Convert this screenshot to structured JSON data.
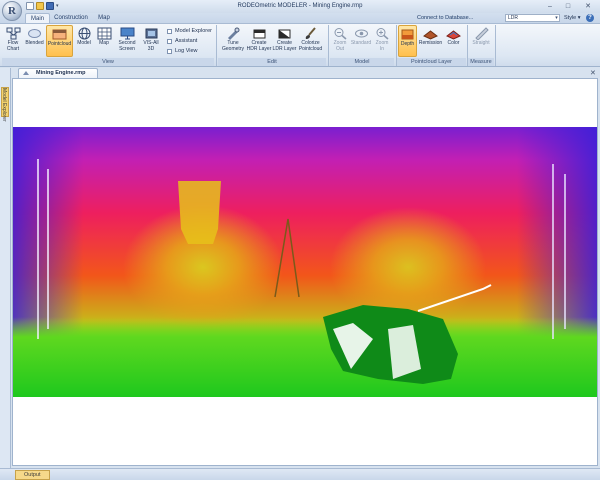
{
  "window": {
    "title": "RODEOmetric MODELER - Mining Engine.rmp",
    "app_logo_letter": "R",
    "minimize_glyph": "–",
    "maximize_glyph": "□",
    "close_glyph": "✕"
  },
  "tabs": [
    {
      "label": "Main",
      "active": true
    },
    {
      "label": "Construction",
      "active": false
    },
    {
      "label": "Map",
      "active": false
    }
  ],
  "top_right": {
    "connect_label": "Connect to Database...",
    "layer_value": "LDR",
    "style_label": "Style",
    "help_glyph": "?"
  },
  "ribbon": {
    "view": {
      "caption": "View",
      "buttons": [
        {
          "label": "Flow Chart",
          "icon": "flow-chart-icon"
        },
        {
          "label": "Blended",
          "icon": "blended-icon"
        },
        {
          "label": "Pointcloud",
          "icon": "pointcloud-icon",
          "active": true
        },
        {
          "label": "Model",
          "icon": "globe-icon"
        },
        {
          "label": "Map",
          "icon": "map-icon"
        },
        {
          "label": "Second Screen",
          "icon": "monitor-icon"
        },
        {
          "label": "VIS-All 3D",
          "icon": "vis-all-3d-icon"
        }
      ],
      "checkboxes": [
        {
          "label": "Model Explorer",
          "checked": false
        },
        {
          "label": "Assistant",
          "checked": false
        },
        {
          "label": "Log View",
          "checked": false
        }
      ]
    },
    "edit": {
      "caption": "Edit",
      "buttons": [
        {
          "label": "Tune Geometry",
          "icon": "tune-geometry-icon"
        },
        {
          "label": "Create HDR Layer",
          "icon": "hdr-layer-icon"
        },
        {
          "label": "Create LDR Layer",
          "icon": "ldr-layer-icon"
        },
        {
          "label": "Colorize Pointcloud",
          "icon": "brush-icon"
        }
      ]
    },
    "model": {
      "caption": "Model",
      "buttons": [
        {
          "label": "Zoom Out",
          "icon": "zoom-out-icon",
          "disabled": true
        },
        {
          "label": "Standard",
          "icon": "eye-icon",
          "disabled": true
        },
        {
          "label": "Zoom In",
          "icon": "zoom-in-icon",
          "disabled": true
        }
      ]
    },
    "pointcloud_layer": {
      "caption": "Pointcloud Layer",
      "buttons": [
        {
          "label": "Depth",
          "icon": "depth-icon",
          "active": true
        },
        {
          "label": "Remission",
          "icon": "remission-icon"
        },
        {
          "label": "Color",
          "icon": "color-icon"
        }
      ]
    },
    "measure": {
      "caption": "Measure",
      "buttons": [
        {
          "label": "Straight",
          "icon": "ruler-icon",
          "disabled": true
        }
      ]
    }
  },
  "document": {
    "tab_label": "Mining Engine.rmp",
    "close_glyph": "✕"
  },
  "sidebar": {
    "label": "Model Explorer"
  },
  "statusbar": {
    "output_label": "Output"
  },
  "colors": {
    "accent": "#ffc04d",
    "ribbon_bg": "#dde7f3",
    "depth_near": "#1fd21f",
    "depth_mid": "#ff1f2a",
    "depth_far": "#3b1fd8"
  }
}
